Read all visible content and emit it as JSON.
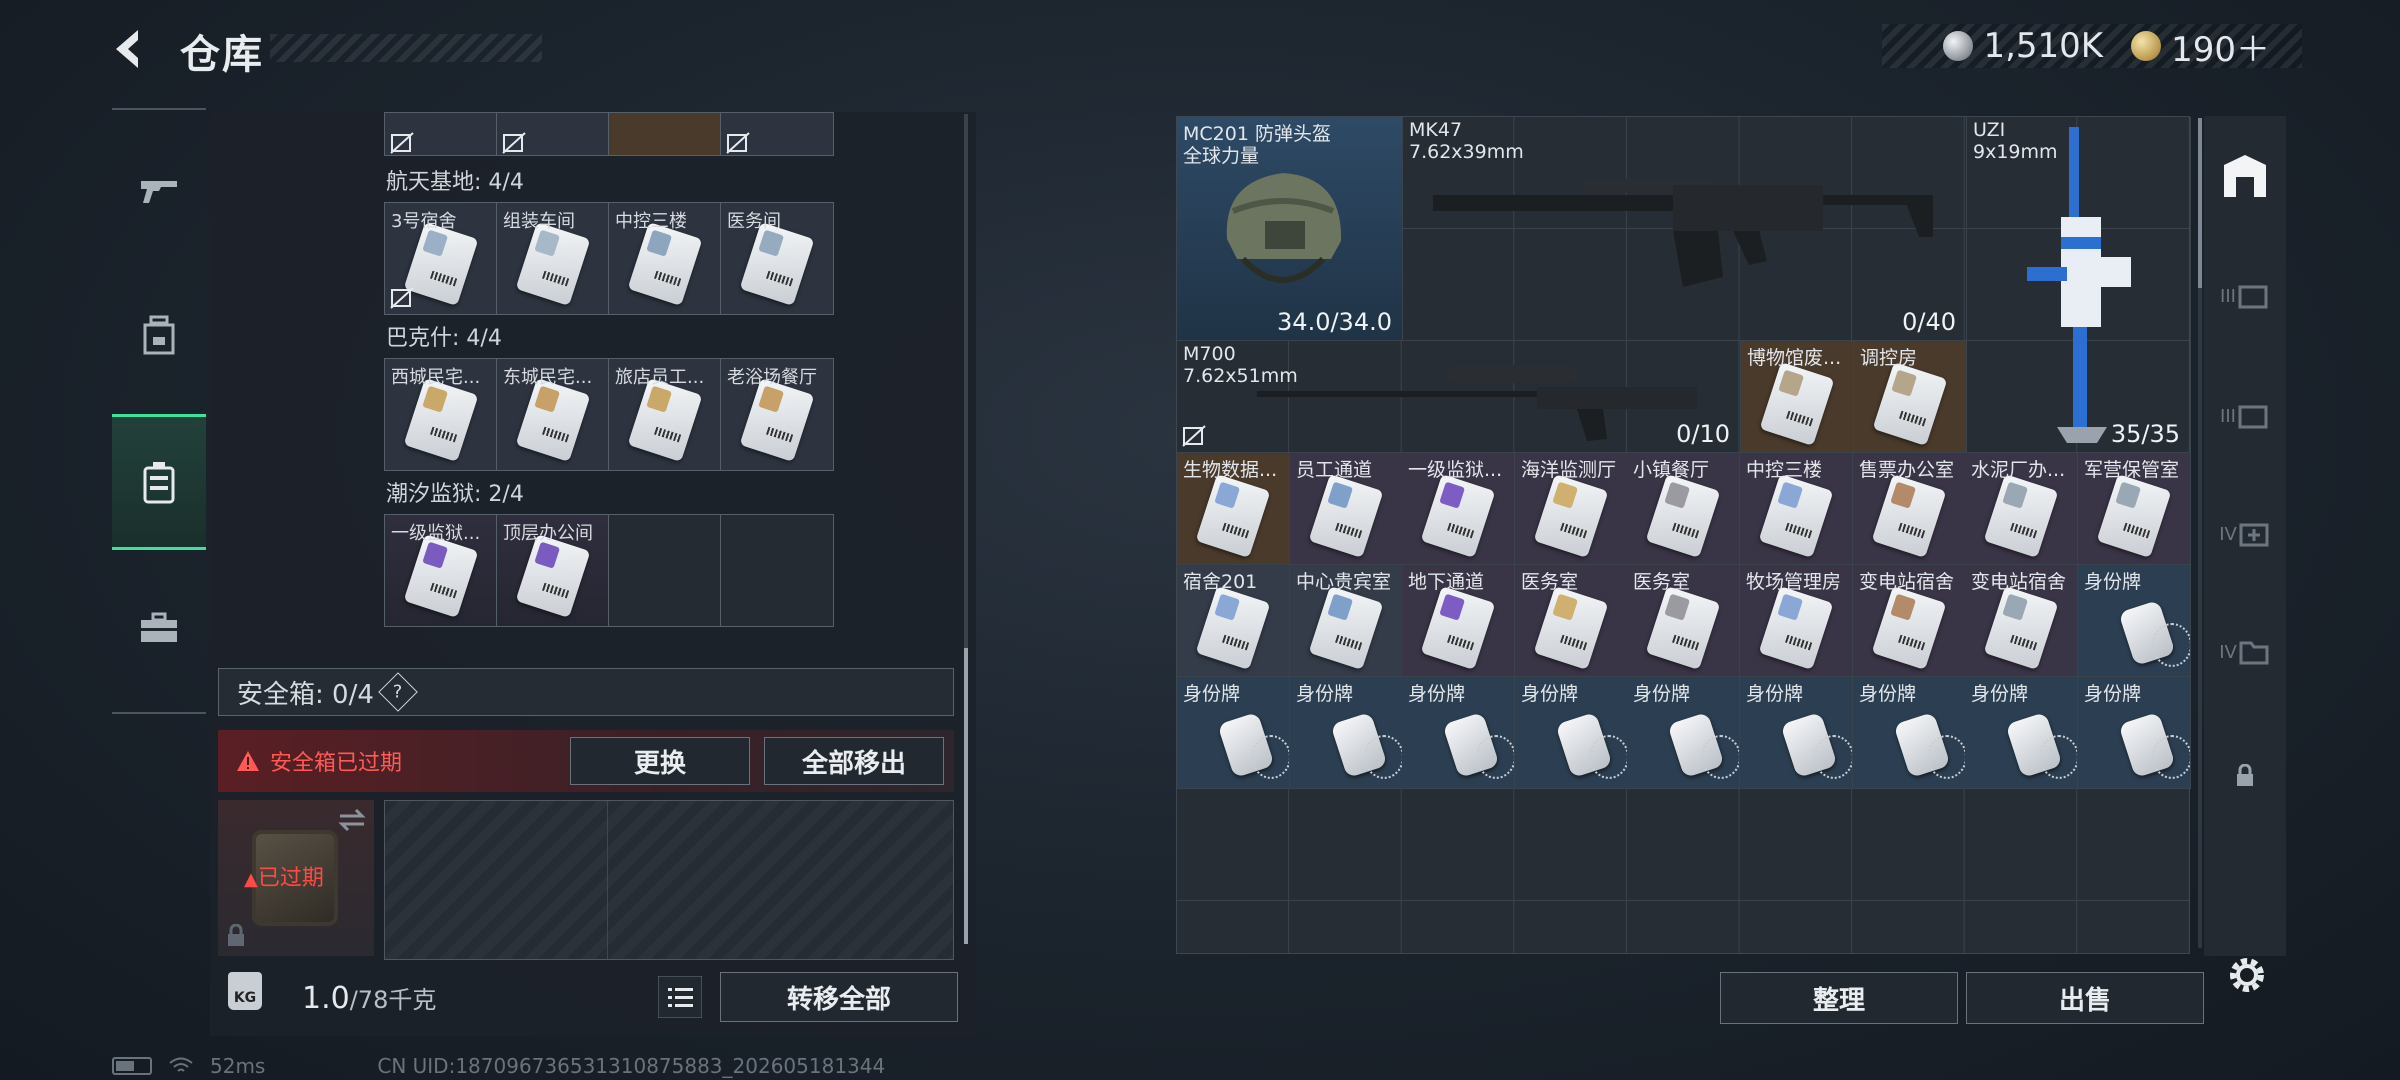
{
  "header": {
    "title": "仓库"
  },
  "currency": [
    {
      "icon": "silver-coin-icon",
      "value": "1,510K"
    },
    {
      "icon": "gold-coin-icon",
      "value": "190＋"
    }
  ],
  "leftnav": [
    {
      "icon": "gun-icon",
      "active": false
    },
    {
      "icon": "backpack-icon",
      "active": false
    },
    {
      "icon": "safe-case-icon",
      "active": true
    },
    {
      "icon": "toolbox-icon",
      "active": false
    }
  ],
  "keygroups": [
    {
      "label": "航天基地: 4/4",
      "slots": [
        "3号宿舍",
        "组装车间",
        "中控三楼",
        "医务间"
      ]
    },
    {
      "label": "巴克什: 4/4",
      "slots": [
        "西城民宅...",
        "东城民宅...",
        "旅店员工...",
        "老浴场餐厅"
      ]
    },
    {
      "label": "潮汐监狱: 2/4",
      "slots": [
        "一级监狱...",
        "顶层办公间",
        "",
        ""
      ]
    }
  ],
  "safebox": {
    "label": "安全箱: 0/4",
    "help": "?",
    "expired_msg": "安全箱已过期",
    "replace_btn": "更换",
    "remove_all_btn": "全部移出",
    "expired_tag": "已过期"
  },
  "weight": {
    "current": "1.0",
    "max": "/78千克",
    "icon_label": "KG"
  },
  "transfer_all_btn": "转移全部",
  "stash": {
    "helmet": {
      "name": "MC201 防弹头盔",
      "sub": "全球力量",
      "count": "34.0/34.0"
    },
    "mk47": {
      "name": "MK47",
      "sub": "7.62x39mm",
      "count": "0/40"
    },
    "uzi": {
      "name": "UZI",
      "sub": "9x19mm",
      "count": "35/35"
    },
    "m700": {
      "name": "M700",
      "sub": "7.62x51mm",
      "count": "0/10"
    },
    "row2_cards": [
      "博物馆废...",
      "调控房"
    ],
    "row3": [
      "生物数据...",
      "员工通道",
      "一级监狱...",
      "海洋监测厅",
      "小镇餐厅",
      "中控三楼",
      "售票办公室",
      "水泥厂办...",
      "军营保管室"
    ],
    "row4": [
      "宿舍201",
      "中心贵宾室",
      "地下通道",
      "医务室",
      "医务室",
      "牧场管理房",
      "变电站宿舍",
      "变电站宿舍",
      "身份牌"
    ],
    "row5": [
      "身份牌",
      "身份牌",
      "身份牌",
      "身份牌",
      "身份牌",
      "身份牌",
      "身份牌",
      "身份牌",
      "身份牌"
    ]
  },
  "actions": {
    "sort": "整理",
    "sell": "出售"
  },
  "rightnav": [
    "III",
    "III",
    "IV",
    "IV"
  ],
  "footer": {
    "ping": "52ms",
    "uid": "CN UID:1870967365313108758​83_202605181344"
  }
}
